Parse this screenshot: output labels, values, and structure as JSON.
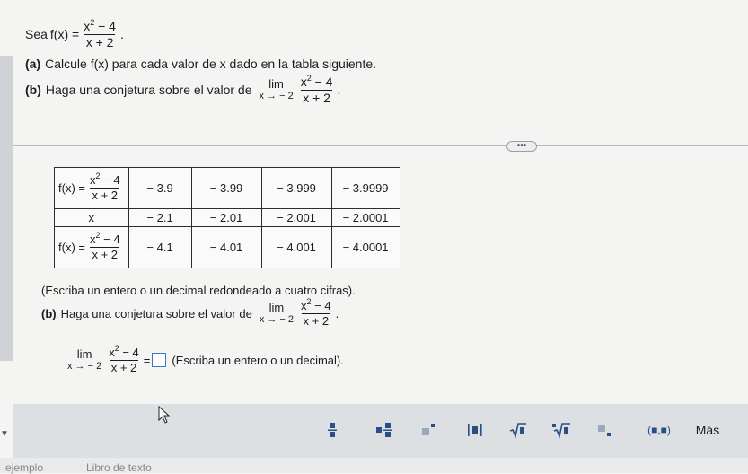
{
  "intro": {
    "prefix": "Sea ",
    "fx": "f(x) =",
    "num": "x",
    "num_tail": " − 4",
    "exp": "2",
    "den": "x + 2",
    "period": "."
  },
  "part_a": {
    "label": "(a)",
    "text": "Calcule f(x) para cada valor de x dado en la tabla siguiente."
  },
  "part_b_header": {
    "label": "(b)",
    "text": "Haga una conjetura sobre el valor de",
    "lim_word": "lim",
    "lim_sub": "x → − 2",
    "num": "x",
    "exp": "2",
    "num_tail": " − 4",
    "den": "x + 2",
    "period": "."
  },
  "expander": {
    "label": "•••"
  },
  "table": {
    "fx_label": "f(x) =",
    "frac_num": "x",
    "frac_exp": "2",
    "frac_tail": " − 4",
    "frac_den": "x + 2",
    "x_label": "x",
    "row1": [
      "− 3.9",
      "− 3.99",
      "− 3.999",
      "− 3.9999"
    ],
    "row2": [
      "− 2.1",
      "− 2.01",
      "− 2.001",
      "− 2.0001"
    ],
    "row3": [
      "− 4.1",
      "− 4.01",
      "− 4.001",
      "− 4.0001"
    ]
  },
  "note": "(Escriba un entero o un decimal redondeado a cuatro cifras).",
  "part_b": {
    "label": "(b)",
    "text": "Haga una conjetura sobre el valor de",
    "lim_word": "lim",
    "lim_sub": "x → − 2",
    "num": "x",
    "exp": "2",
    "num_tail": " − 4",
    "den": "x + 2",
    "period": "."
  },
  "answer": {
    "lim_word": "lim",
    "lim_sub": "x → − 2",
    "num": "x",
    "exp": "2",
    "num_tail": " − 4",
    "den": "x + 2",
    "equals": "=",
    "hint": "(Escriba un entero o un decimal)."
  },
  "toolbar": {
    "mas_label": "Más",
    "paren_label": "(■,■)"
  },
  "bottom": {
    "left": "ejemplo",
    "right": "Libro de texto"
  }
}
